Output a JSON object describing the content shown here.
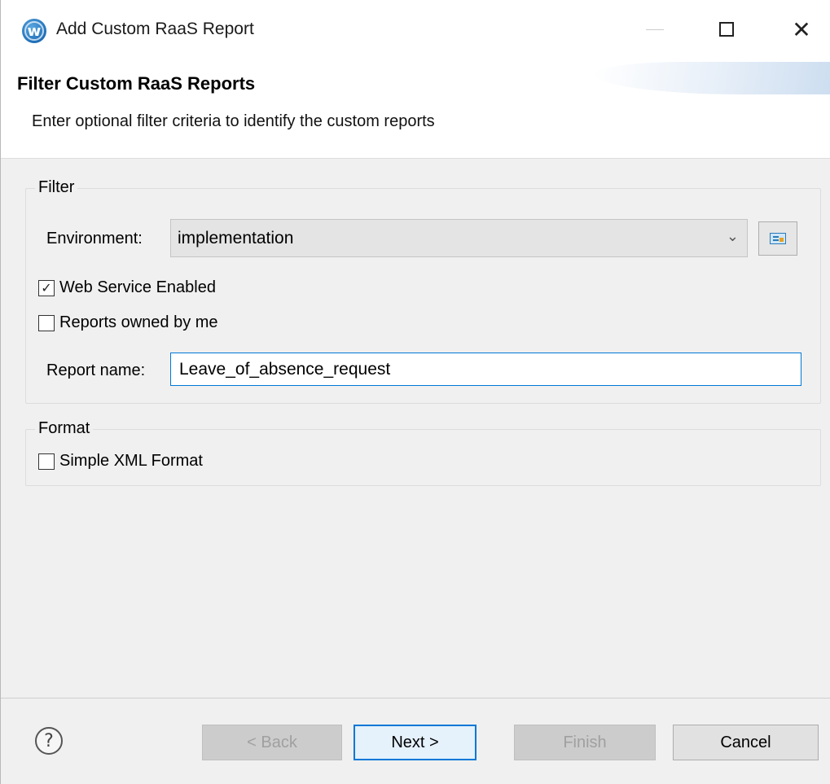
{
  "window": {
    "title": "Add Custom RaaS Report",
    "icon": "workday-logo-icon",
    "controls": {
      "minimize": "minimize-icon",
      "maximize": "maximize-icon",
      "close": "close-icon",
      "close_glyph": "✕"
    }
  },
  "header": {
    "title": "Filter Custom RaaS Reports",
    "description": "Enter optional filter criteria to identify the custom reports"
  },
  "filter": {
    "legend": "Filter",
    "environment": {
      "label": "Environment:",
      "value": "implementation",
      "arrow": "⌄"
    },
    "web_service_enabled": {
      "label": "Web Service Enabled",
      "checked": true,
      "check_glyph": "✓"
    },
    "owned_by_me": {
      "label": "Reports owned by me",
      "checked": false
    },
    "report_name": {
      "label": "Report name:",
      "value": "Leave_of_absence_request"
    }
  },
  "format": {
    "legend": "Format",
    "simple_xml": {
      "label": "Simple XML Format",
      "checked": false
    }
  },
  "buttons": {
    "help": "?",
    "back": "< Back",
    "next": "Next >",
    "finish": "Finish",
    "cancel": "Cancel"
  },
  "colors": {
    "accent": "#0078d7",
    "disabled_text": "#a0a0a0",
    "dialog_bg": "#f0f0f0"
  }
}
